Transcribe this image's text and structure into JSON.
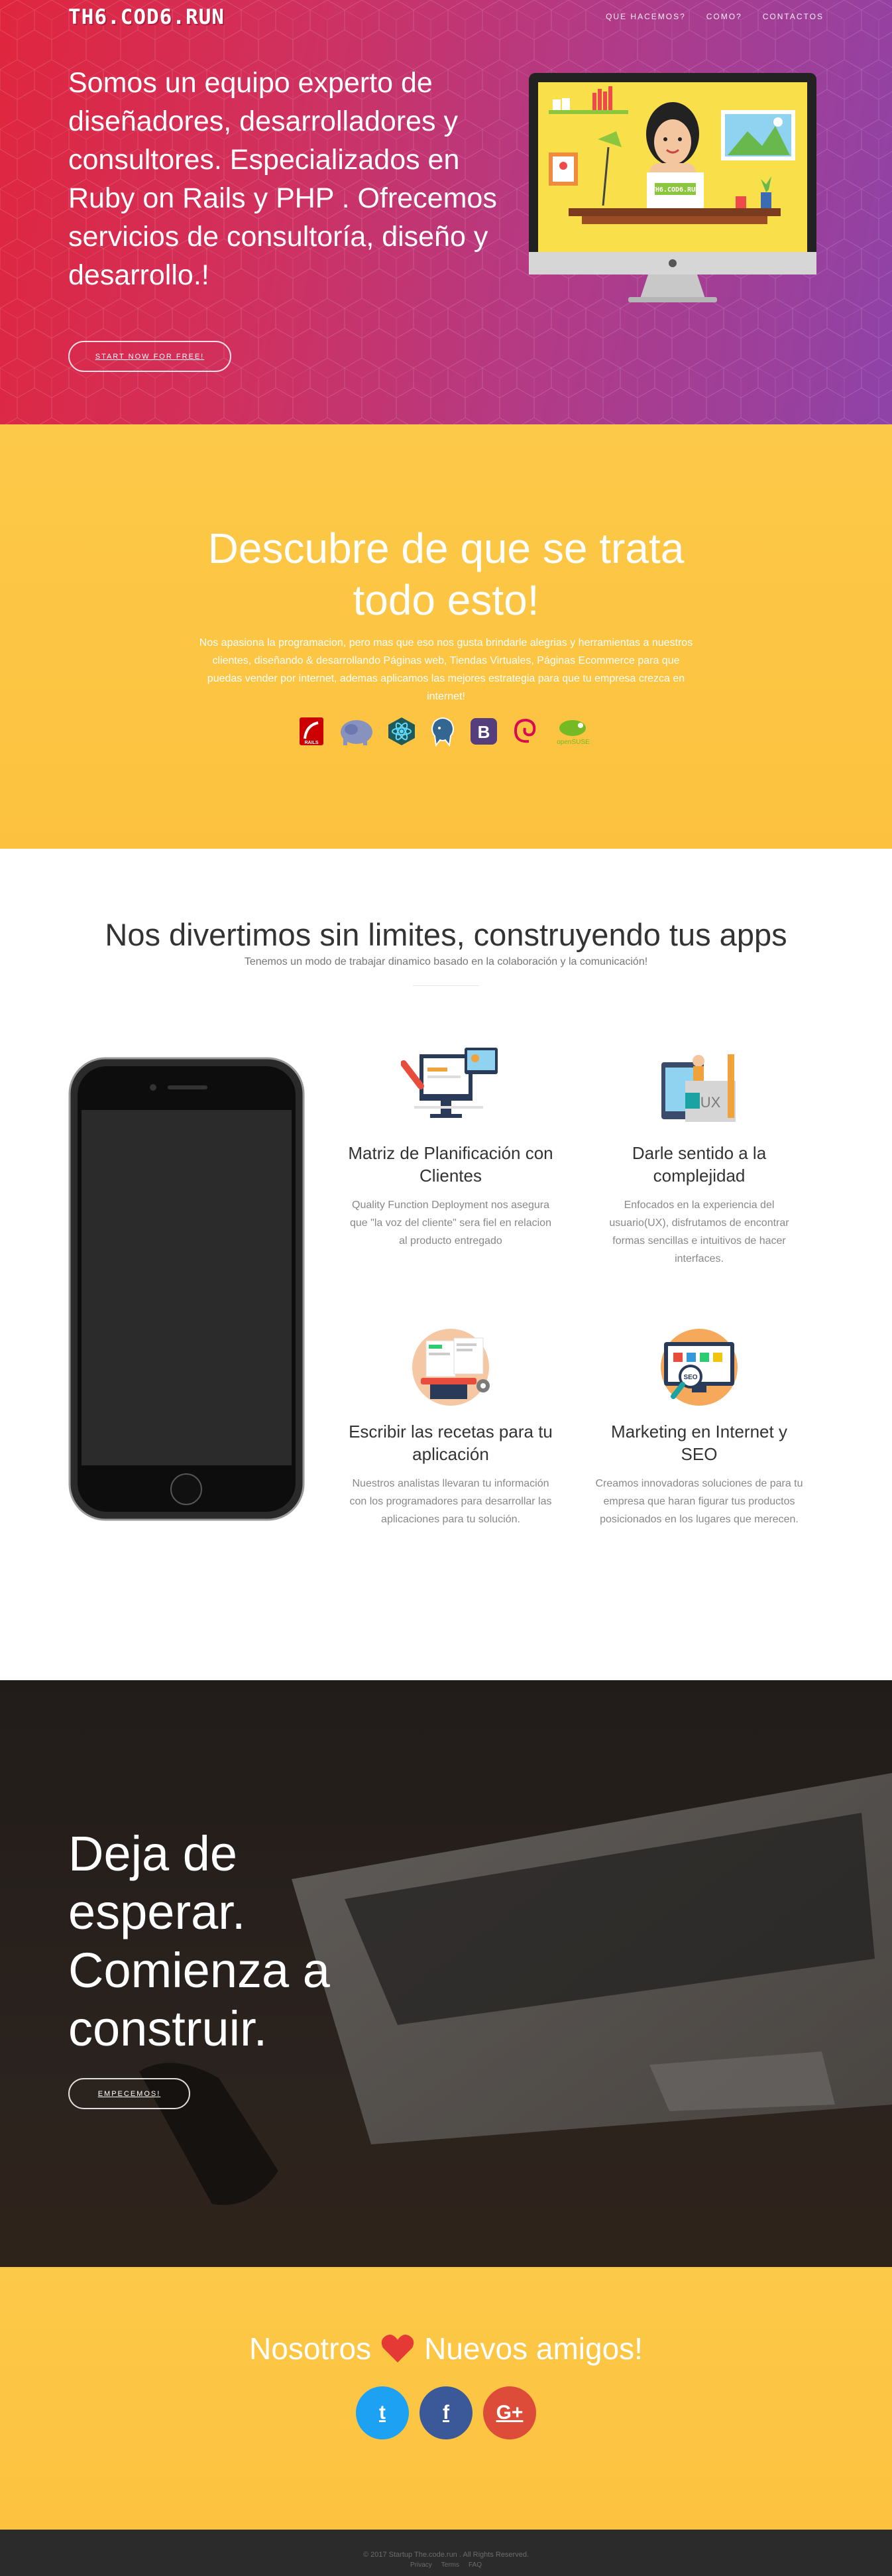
{
  "brand": "TH6.COD6.RUN",
  "nav": [
    "QUE HACEMOS?",
    "COMO?",
    "CONTACTOS"
  ],
  "hero": {
    "headline": "Somos un equipo experto de diseñadores, desarrolladores y consultores. Especializados en Ruby on Rails y PHP . Ofrecemos servicios de consultoría, diseño y desarrollo.!",
    "cta": "START NOW FOR FREE!",
    "monitor_sign": "TH6.COD6.RUN"
  },
  "discover": {
    "title": "Descubre de que se trata todo esto!",
    "text": "Nos apasiona la programacion, pero mas que eso nos gusta brindarle alegrias y herramientas a nuestros clientes, diseñando & desarrollando Páginas web, Tiendas Virtuales, Páginas Ecommerce para que puedas vender por internet, ademas aplicamos las mejores estrategia para que tu empresa crezca en internet!",
    "techs": [
      {
        "icon": "rails-icon",
        "color": "#cc0000",
        "label": "RAILS"
      },
      {
        "icon": "php-icon",
        "color": "#8892bf",
        "label": "php"
      },
      {
        "icon": "react-icon",
        "color": "#1f7a7a",
        "label": ""
      },
      {
        "icon": "postgresql-icon",
        "color": "#336791",
        "label": ""
      },
      {
        "icon": "bootstrap-icon",
        "color": "#563d7c",
        "label": "B"
      },
      {
        "icon": "debian-icon",
        "color": "#d70a53",
        "label": ""
      },
      {
        "icon": "opensuse-icon",
        "color": "#73ba25",
        "label": "openSUSE"
      }
    ]
  },
  "features": {
    "title": "Nos divertimos sin limites, construyendo tus apps",
    "subtitle": "Tenemos un modo de trabajar dinamico basado en la colaboración y la comunicación!",
    "items": [
      {
        "icon": "planning-icon",
        "title": "Matriz de Planificación con Clientes",
        "text": "Quality Function Deployment nos asegura que \"la voz del cliente\" sera fiel en relacion al producto entregado"
      },
      {
        "icon": "ux-icon",
        "title": "Darle sentido a la complejidad",
        "text": "Enfocados en la experiencia del usuario(UX), disfrutamos de encontrar formas sencillas e intuitivos de hacer interfaces."
      },
      {
        "icon": "coding-icon",
        "title": "Escribir las recetas para tu aplicación",
        "text": "Nuestros analistas llevaran tu información con los programadores para desarrollar las aplicaciones para tu solución."
      },
      {
        "icon": "seo-icon",
        "title": "Marketing en Internet y SEO",
        "text": "Creamos innovadoras soluciones de para tu empresa que haran figurar tus productos posicionados en los lugares que merecen."
      }
    ],
    "ux_label": "UX",
    "seo_label": "SEO"
  },
  "cta": {
    "title": "Deja de esperar. Comienza a construir.",
    "button": "EMPECEMOS!"
  },
  "friends": {
    "left": "Nosotros",
    "right": "Nuevos amigos!",
    "socials": [
      {
        "icon": "twitter-icon",
        "glyph": "t"
      },
      {
        "icon": "facebook-icon",
        "glyph": "f"
      },
      {
        "icon": "google-plus-icon",
        "glyph": "G+"
      }
    ]
  },
  "footer": {
    "copyright": "© 2017 Startup The.code.run . All Rights Reserved.",
    "links": [
      "Privacy",
      "Terms",
      "FAQ"
    ]
  },
  "colors": {
    "hero_start": "#e0263e",
    "hero_end": "#8e43a8",
    "yellow": "#fcc23f",
    "dark": "#2b2b2b"
  }
}
